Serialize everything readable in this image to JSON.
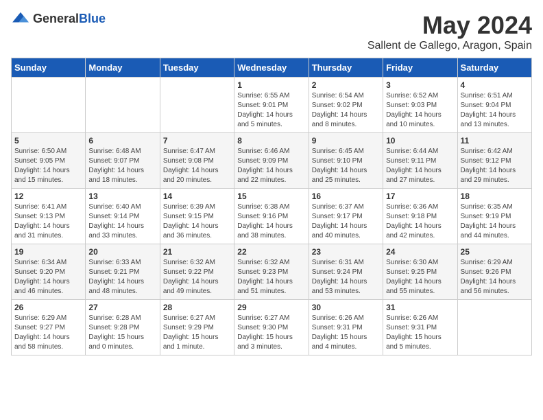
{
  "logo": {
    "general": "General",
    "blue": "Blue"
  },
  "title": "May 2024",
  "location": "Sallent de Gallego, Aragon, Spain",
  "weekdays": [
    "Sunday",
    "Monday",
    "Tuesday",
    "Wednesday",
    "Thursday",
    "Friday",
    "Saturday"
  ],
  "weeks": [
    [
      {
        "day": "",
        "info": ""
      },
      {
        "day": "",
        "info": ""
      },
      {
        "day": "",
        "info": ""
      },
      {
        "day": "1",
        "info": "Sunrise: 6:55 AM\nSunset: 9:01 PM\nDaylight: 14 hours\nand 5 minutes."
      },
      {
        "day": "2",
        "info": "Sunrise: 6:54 AM\nSunset: 9:02 PM\nDaylight: 14 hours\nand 8 minutes."
      },
      {
        "day": "3",
        "info": "Sunrise: 6:52 AM\nSunset: 9:03 PM\nDaylight: 14 hours\nand 10 minutes."
      },
      {
        "day": "4",
        "info": "Sunrise: 6:51 AM\nSunset: 9:04 PM\nDaylight: 14 hours\nand 13 minutes."
      }
    ],
    [
      {
        "day": "5",
        "info": "Sunrise: 6:50 AM\nSunset: 9:05 PM\nDaylight: 14 hours\nand 15 minutes."
      },
      {
        "day": "6",
        "info": "Sunrise: 6:48 AM\nSunset: 9:07 PM\nDaylight: 14 hours\nand 18 minutes."
      },
      {
        "day": "7",
        "info": "Sunrise: 6:47 AM\nSunset: 9:08 PM\nDaylight: 14 hours\nand 20 minutes."
      },
      {
        "day": "8",
        "info": "Sunrise: 6:46 AM\nSunset: 9:09 PM\nDaylight: 14 hours\nand 22 minutes."
      },
      {
        "day": "9",
        "info": "Sunrise: 6:45 AM\nSunset: 9:10 PM\nDaylight: 14 hours\nand 25 minutes."
      },
      {
        "day": "10",
        "info": "Sunrise: 6:44 AM\nSunset: 9:11 PM\nDaylight: 14 hours\nand 27 minutes."
      },
      {
        "day": "11",
        "info": "Sunrise: 6:42 AM\nSunset: 9:12 PM\nDaylight: 14 hours\nand 29 minutes."
      }
    ],
    [
      {
        "day": "12",
        "info": "Sunrise: 6:41 AM\nSunset: 9:13 PM\nDaylight: 14 hours\nand 31 minutes."
      },
      {
        "day": "13",
        "info": "Sunrise: 6:40 AM\nSunset: 9:14 PM\nDaylight: 14 hours\nand 33 minutes."
      },
      {
        "day": "14",
        "info": "Sunrise: 6:39 AM\nSunset: 9:15 PM\nDaylight: 14 hours\nand 36 minutes."
      },
      {
        "day": "15",
        "info": "Sunrise: 6:38 AM\nSunset: 9:16 PM\nDaylight: 14 hours\nand 38 minutes."
      },
      {
        "day": "16",
        "info": "Sunrise: 6:37 AM\nSunset: 9:17 PM\nDaylight: 14 hours\nand 40 minutes."
      },
      {
        "day": "17",
        "info": "Sunrise: 6:36 AM\nSunset: 9:18 PM\nDaylight: 14 hours\nand 42 minutes."
      },
      {
        "day": "18",
        "info": "Sunrise: 6:35 AM\nSunset: 9:19 PM\nDaylight: 14 hours\nand 44 minutes."
      }
    ],
    [
      {
        "day": "19",
        "info": "Sunrise: 6:34 AM\nSunset: 9:20 PM\nDaylight: 14 hours\nand 46 minutes."
      },
      {
        "day": "20",
        "info": "Sunrise: 6:33 AM\nSunset: 9:21 PM\nDaylight: 14 hours\nand 48 minutes."
      },
      {
        "day": "21",
        "info": "Sunrise: 6:32 AM\nSunset: 9:22 PM\nDaylight: 14 hours\nand 49 minutes."
      },
      {
        "day": "22",
        "info": "Sunrise: 6:32 AM\nSunset: 9:23 PM\nDaylight: 14 hours\nand 51 minutes."
      },
      {
        "day": "23",
        "info": "Sunrise: 6:31 AM\nSunset: 9:24 PM\nDaylight: 14 hours\nand 53 minutes."
      },
      {
        "day": "24",
        "info": "Sunrise: 6:30 AM\nSunset: 9:25 PM\nDaylight: 14 hours\nand 55 minutes."
      },
      {
        "day": "25",
        "info": "Sunrise: 6:29 AM\nSunset: 9:26 PM\nDaylight: 14 hours\nand 56 minutes."
      }
    ],
    [
      {
        "day": "26",
        "info": "Sunrise: 6:29 AM\nSunset: 9:27 PM\nDaylight: 14 hours\nand 58 minutes."
      },
      {
        "day": "27",
        "info": "Sunrise: 6:28 AM\nSunset: 9:28 PM\nDaylight: 15 hours\nand 0 minutes."
      },
      {
        "day": "28",
        "info": "Sunrise: 6:27 AM\nSunset: 9:29 PM\nDaylight: 15 hours\nand 1 minute."
      },
      {
        "day": "29",
        "info": "Sunrise: 6:27 AM\nSunset: 9:30 PM\nDaylight: 15 hours\nand 3 minutes."
      },
      {
        "day": "30",
        "info": "Sunrise: 6:26 AM\nSunset: 9:31 PM\nDaylight: 15 hours\nand 4 minutes."
      },
      {
        "day": "31",
        "info": "Sunrise: 6:26 AM\nSunset: 9:31 PM\nDaylight: 15 hours\nand 5 minutes."
      },
      {
        "day": "",
        "info": ""
      }
    ]
  ]
}
